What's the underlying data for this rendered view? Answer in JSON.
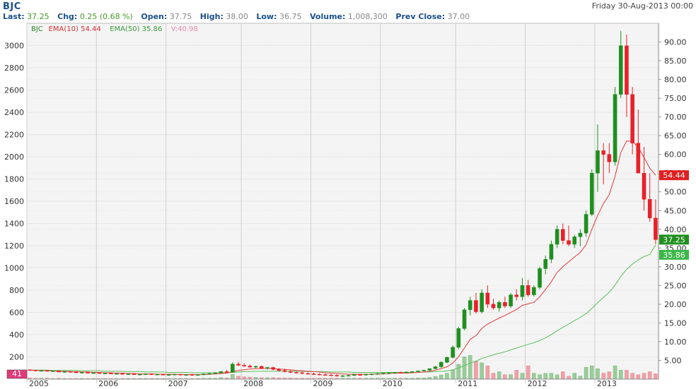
{
  "header": {
    "ticker": "BJC",
    "date": "Friday 30-Aug-2013 00:00",
    "stats": [
      {
        "label": "Last:",
        "value": "37.25"
      },
      {
        "label": "Chg:",
        "value": "0.25 (0.68 %)"
      },
      {
        "label": "Open:",
        "value": "37.75"
      },
      {
        "label": "High:",
        "value": "38.00"
      },
      {
        "label": "Low:",
        "value": "36.75"
      },
      {
        "label": "Volume:",
        "value": "1,008,300"
      },
      {
        "label": "Prev Close:",
        "value": "37.00"
      }
    ]
  },
  "legend": [
    {
      "text": "BJC",
      "color": "#2a8a2a"
    },
    {
      "text": "EMA(10) 54.44",
      "color": "#d43030"
    },
    {
      "text": "EMA(50) 35.86",
      "color": "#3a9a3a"
    },
    {
      "text": "V:40.98",
      "color": "#e888b0"
    }
  ],
  "badges": {
    "ema10": "54.44",
    "last": "37.25",
    "ema50": "35.86",
    "volume": "41"
  },
  "colors": {
    "up": "#1f8f1f",
    "down": "#e8202a",
    "ema10": "#e03838",
    "ema50": "#58c058",
    "vol_up": "#9acd9a",
    "vol_down": "#f0a0a8",
    "grid": "#e6e6e6",
    "bg": "#f4f4f4"
  },
  "chart_data": {
    "type": "candlestick",
    "x_labels": [
      "2005",
      "2006",
      "2007",
      "2008",
      "2009",
      "2010",
      "2011",
      "2012",
      "2013"
    ],
    "left_axis": {
      "ticks": [
        200,
        400,
        600,
        800,
        1000,
        1200,
        1400,
        1600,
        1800,
        2000,
        2200,
        2400,
        2600,
        2800,
        3000
      ],
      "range": [
        0,
        3200
      ]
    },
    "right_axis": {
      "ticks": [
        "5.00",
        "10.00",
        "15.00",
        "20.00",
        "25.00",
        "30.00",
        "35.00",
        "40.00",
        "45.00",
        "50.00",
        "55.00",
        "60.00",
        "65.00",
        "70.00",
        "75.00",
        "80.00",
        "85.00",
        "90.00"
      ],
      "range": [
        0,
        95
      ]
    },
    "candles": [
      [
        2.5,
        2.6,
        2.2,
        2.4
      ],
      [
        2.4,
        2.5,
        2.1,
        2.2
      ],
      [
        2.2,
        2.4,
        2.0,
        2.3
      ],
      [
        2.3,
        2.4,
        2.0,
        2.1
      ],
      [
        2.1,
        2.3,
        1.9,
        2.2
      ],
      [
        2.2,
        2.3,
        1.8,
        1.9
      ],
      [
        1.9,
        2.1,
        1.7,
        2.0
      ],
      [
        2.0,
        2.2,
        1.8,
        1.9
      ],
      [
        1.9,
        2.0,
        1.6,
        1.7
      ],
      [
        1.7,
        1.9,
        1.5,
        1.8
      ],
      [
        1.8,
        1.9,
        1.5,
        1.6
      ],
      [
        1.6,
        1.8,
        1.4,
        1.7
      ],
      [
        1.7,
        1.8,
        1.4,
        1.5
      ],
      [
        1.5,
        1.7,
        1.3,
        1.6
      ],
      [
        1.6,
        1.7,
        1.3,
        1.4
      ],
      [
        1.4,
        1.6,
        1.2,
        1.5
      ],
      [
        1.5,
        1.6,
        1.2,
        1.3
      ],
      [
        1.3,
        1.5,
        1.1,
        1.4
      ],
      [
        1.4,
        1.5,
        1.1,
        1.2
      ],
      [
        1.2,
        1.4,
        1.0,
        1.3
      ],
      [
        1.3,
        1.5,
        1.1,
        1.4
      ],
      [
        1.4,
        1.5,
        1.1,
        1.2
      ],
      [
        1.2,
        1.4,
        1.0,
        1.3
      ],
      [
        1.3,
        1.4,
        1.0,
        1.1
      ],
      [
        1.1,
        1.3,
        0.9,
        1.2
      ],
      [
        1.2,
        1.4,
        1.0,
        1.3
      ],
      [
        1.3,
        1.4,
        1.0,
        1.1
      ],
      [
        1.1,
        1.3,
        0.9,
        1.2
      ],
      [
        1.2,
        1.4,
        1.0,
        1.1
      ],
      [
        1.1,
        1.3,
        0.9,
        1.2
      ],
      [
        1.2,
        1.5,
        1.0,
        1.4
      ],
      [
        1.4,
        1.6,
        1.2,
        1.5
      ],
      [
        1.5,
        1.8,
        1.3,
        1.7
      ],
      [
        1.7,
        2.2,
        1.5,
        2.0
      ],
      [
        2.0,
        2.5,
        1.6,
        1.8
      ],
      [
        1.8,
        4.5,
        1.7,
        4.0
      ],
      [
        4.0,
        4.6,
        3.5,
        3.7
      ],
      [
        3.7,
        4.2,
        3.2,
        3.5
      ],
      [
        3.5,
        3.9,
        3.0,
        3.2
      ],
      [
        3.2,
        3.6,
        2.9,
        3.4
      ],
      [
        3.4,
        3.6,
        2.7,
        2.9
      ],
      [
        2.9,
        3.3,
        2.5,
        3.1
      ],
      [
        3.1,
        3.3,
        2.4,
        2.6
      ],
      [
        2.6,
        2.9,
        2.0,
        2.3
      ],
      [
        2.3,
        2.8,
        1.8,
        2.0
      ],
      [
        2.0,
        2.4,
        1.6,
        1.8
      ],
      [
        1.8,
        2.1,
        1.5,
        1.7
      ],
      [
        1.7,
        2.0,
        1.3,
        1.5
      ],
      [
        1.5,
        1.8,
        1.2,
        1.4
      ],
      [
        1.4,
        1.7,
        1.1,
        1.3
      ],
      [
        1.3,
        1.6,
        1.0,
        1.2
      ],
      [
        1.2,
        1.5,
        0.9,
        1.1
      ],
      [
        1.1,
        1.4,
        0.8,
        1.0
      ],
      [
        1.0,
        1.3,
        0.7,
        0.8
      ],
      [
        0.8,
        1.1,
        0.6,
        0.9
      ],
      [
        0.9,
        1.2,
        0.7,
        1.0
      ],
      [
        1.0,
        1.3,
        0.8,
        1.2
      ],
      [
        1.2,
        1.4,
        0.9,
        1.1
      ],
      [
        1.1,
        1.4,
        0.9,
        1.3
      ],
      [
        1.3,
        1.5,
        1.0,
        1.4
      ],
      [
        1.4,
        1.6,
        1.1,
        1.5
      ],
      [
        1.5,
        1.7,
        1.2,
        1.6
      ],
      [
        1.6,
        1.8,
        1.3,
        1.7
      ],
      [
        1.7,
        1.9,
        1.4,
        1.8
      ],
      [
        1.8,
        2.0,
        1.5,
        1.7
      ],
      [
        1.7,
        2.0,
        1.5,
        1.9
      ],
      [
        1.9,
        2.1,
        1.6,
        2.0
      ],
      [
        2.0,
        2.3,
        1.8,
        2.2
      ],
      [
        2.2,
        2.5,
        2.0,
        2.4
      ],
      [
        2.4,
        2.9,
        2.1,
        2.8
      ],
      [
        2.8,
        3.5,
        2.6,
        3.3
      ],
      [
        3.3,
        4.8,
        3.0,
        4.5
      ],
      [
        4.5,
        6.0,
        4.2,
        5.8
      ],
      [
        5.8,
        9.0,
        5.5,
        8.5
      ],
      [
        8.5,
        14.0,
        8.0,
        13.5
      ],
      [
        13.5,
        19.0,
        13.0,
        18.5
      ],
      [
        18.5,
        22.0,
        17.0,
        21.0
      ],
      [
        21.0,
        23.0,
        17.5,
        18.0
      ],
      [
        18.0,
        24.0,
        17.5,
        23.0
      ],
      [
        23.0,
        25.0,
        19.0,
        20.0
      ],
      [
        20.0,
        21.5,
        18.5,
        19.0
      ],
      [
        19.0,
        21.0,
        18.0,
        20.5
      ],
      [
        20.5,
        22.0,
        19.0,
        19.5
      ],
      [
        19.5,
        23.0,
        19.0,
        22.5
      ],
      [
        22.5,
        24.0,
        21.0,
        22.0
      ],
      [
        22.0,
        27.0,
        21.0,
        25.0
      ],
      [
        25.0,
        26.5,
        22.0,
        22.5
      ],
      [
        22.5,
        25.0,
        22.0,
        24.5
      ],
      [
        24.5,
        30.0,
        24.0,
        29.5
      ],
      [
        29.5,
        33.0,
        28.0,
        32.0
      ],
      [
        32.0,
        37.0,
        31.0,
        36.0
      ],
      [
        36.0,
        41.0,
        35.0,
        40.0
      ],
      [
        40.0,
        41.5,
        36.0,
        37.0
      ],
      [
        37.0,
        41.0,
        35.5,
        36.0
      ],
      [
        36.0,
        38.5,
        35.0,
        38.0
      ],
      [
        38.0,
        40.0,
        35.5,
        39.0
      ],
      [
        39.0,
        45.0,
        38.0,
        44.0
      ],
      [
        44.0,
        56.0,
        43.5,
        55.0
      ],
      [
        55.0,
        68.0,
        50.0,
        61.0
      ],
      [
        61.0,
        63.0,
        52.0,
        60.0
      ],
      [
        60.0,
        63.0,
        55.0,
        58.0
      ],
      [
        58.0,
        78.0,
        57.0,
        76.0
      ],
      [
        76.0,
        93.0,
        75.0,
        89.0
      ],
      [
        89.0,
        92.0,
        70.0,
        76.0
      ],
      [
        76.0,
        78.0,
        60.0,
        63.0
      ],
      [
        63.0,
        72.0,
        58.0,
        55.0
      ],
      [
        55.0,
        62.0,
        45.0,
        48.0
      ],
      [
        48.0,
        55.0,
        42.0,
        43.0
      ],
      [
        43.0,
        48.0,
        36.0,
        37.25
      ]
    ],
    "ema10": [
      2.4,
      2.3,
      2.3,
      2.2,
      2.2,
      2.1,
      2.1,
      2.0,
      2.0,
      1.9,
      1.9,
      1.8,
      1.8,
      1.7,
      1.7,
      1.6,
      1.6,
      1.5,
      1.5,
      1.4,
      1.4,
      1.4,
      1.3,
      1.3,
      1.3,
      1.3,
      1.2,
      1.2,
      1.2,
      1.2,
      1.2,
      1.3,
      1.4,
      1.5,
      1.6,
      2.0,
      2.3,
      2.5,
      2.7,
      2.8,
      2.8,
      2.9,
      2.8,
      2.7,
      2.6,
      2.5,
      2.3,
      2.2,
      2.1,
      2.0,
      1.9,
      1.7,
      1.6,
      1.5,
      1.4,
      1.3,
      1.3,
      1.3,
      1.3,
      1.3,
      1.4,
      1.4,
      1.5,
      1.6,
      1.6,
      1.6,
      1.7,
      1.8,
      1.9,
      2.1,
      2.4,
      2.8,
      3.3,
      4.3,
      6.0,
      8.3,
      10.6,
      11.6,
      13.5,
      14.7,
      15.5,
      16.3,
      17.0,
      17.8,
      18.6,
      19.7,
      20.1,
      20.5,
      22.0,
      23.9,
      26.0,
      28.5,
      30.0,
      31.3,
      32.6,
      33.8,
      35.9,
      40.0,
      43.7,
      46.9,
      49.3,
      54.2,
      60.5,
      63.6,
      63.5,
      61.9,
      59.2,
      56.3,
      54.44
    ],
    "ema50": [
      2.4,
      2.4,
      2.4,
      2.4,
      2.3,
      2.3,
      2.3,
      2.3,
      2.3,
      2.2,
      2.2,
      2.2,
      2.2,
      2.1,
      2.1,
      2.1,
      2.1,
      2.0,
      2.0,
      2.0,
      1.9,
      1.9,
      1.9,
      1.9,
      1.8,
      1.8,
      1.8,
      1.8,
      1.7,
      1.7,
      1.7,
      1.7,
      1.7,
      1.7,
      1.7,
      1.8,
      1.9,
      2.0,
      2.0,
      2.1,
      2.1,
      2.1,
      2.1,
      2.1,
      2.1,
      2.1,
      2.1,
      2.1,
      2.0,
      2.0,
      2.0,
      2.0,
      1.9,
      1.9,
      1.9,
      1.9,
      1.8,
      1.8,
      1.8,
      1.8,
      1.8,
      1.8,
      1.8,
      1.8,
      1.8,
      1.8,
      1.8,
      1.8,
      1.9,
      1.9,
      2.0,
      2.1,
      2.2,
      2.5,
      3.0,
      3.6,
      4.3,
      4.8,
      5.5,
      6.0,
      6.5,
      6.9,
      7.3,
      7.8,
      8.3,
      8.8,
      9.3,
      9.7,
      10.3,
      11.0,
      11.9,
      12.9,
      13.8,
      14.7,
      15.6,
      16.5,
      17.5,
      18.9,
      20.4,
      21.8,
      23.2,
      25.1,
      27.4,
      29.3,
      30.7,
      31.8,
      32.7,
      33.3,
      35.86
    ],
    "volume": [
      0.4,
      0.3,
      0.3,
      0.3,
      0.2,
      0.3,
      0.2,
      0.2,
      0.2,
      0.2,
      0.2,
      0.2,
      0.2,
      0.2,
      0.2,
      0.2,
      0.2,
      0.2,
      0.2,
      0.2,
      0.2,
      0.2,
      0.2,
      0.2,
      0.2,
      0.2,
      0.2,
      0.2,
      0.2,
      0.2,
      0.3,
      0.3,
      0.3,
      0.5,
      0.4,
      1.6,
      1.0,
      0.8,
      0.7,
      0.6,
      0.5,
      0.5,
      0.5,
      0.4,
      0.4,
      0.4,
      0.3,
      0.3,
      0.3,
      0.3,
      0.3,
      0.3,
      0.3,
      0.3,
      0.3,
      0.3,
      0.3,
      0.3,
      0.3,
      0.3,
      0.3,
      0.3,
      0.3,
      0.3,
      0.3,
      0.3,
      0.3,
      0.4,
      0.4,
      0.6,
      0.9,
      1.4,
      2.0,
      3.0,
      5.0,
      7.5,
      8.0,
      6.0,
      5.5,
      4.5,
      2.0,
      2.5,
      1.5,
      1.5,
      3.0,
      2.0,
      4.5,
      2.0,
      1.5,
      2.0,
      2.0,
      1.5,
      2.5,
      1.0,
      2.0,
      1.0,
      4.0,
      4.5,
      3.5,
      2.0,
      2.5,
      4.5,
      3.0,
      3.0,
      2.0,
      1.5,
      2.0,
      2.5,
      1.8
    ]
  }
}
